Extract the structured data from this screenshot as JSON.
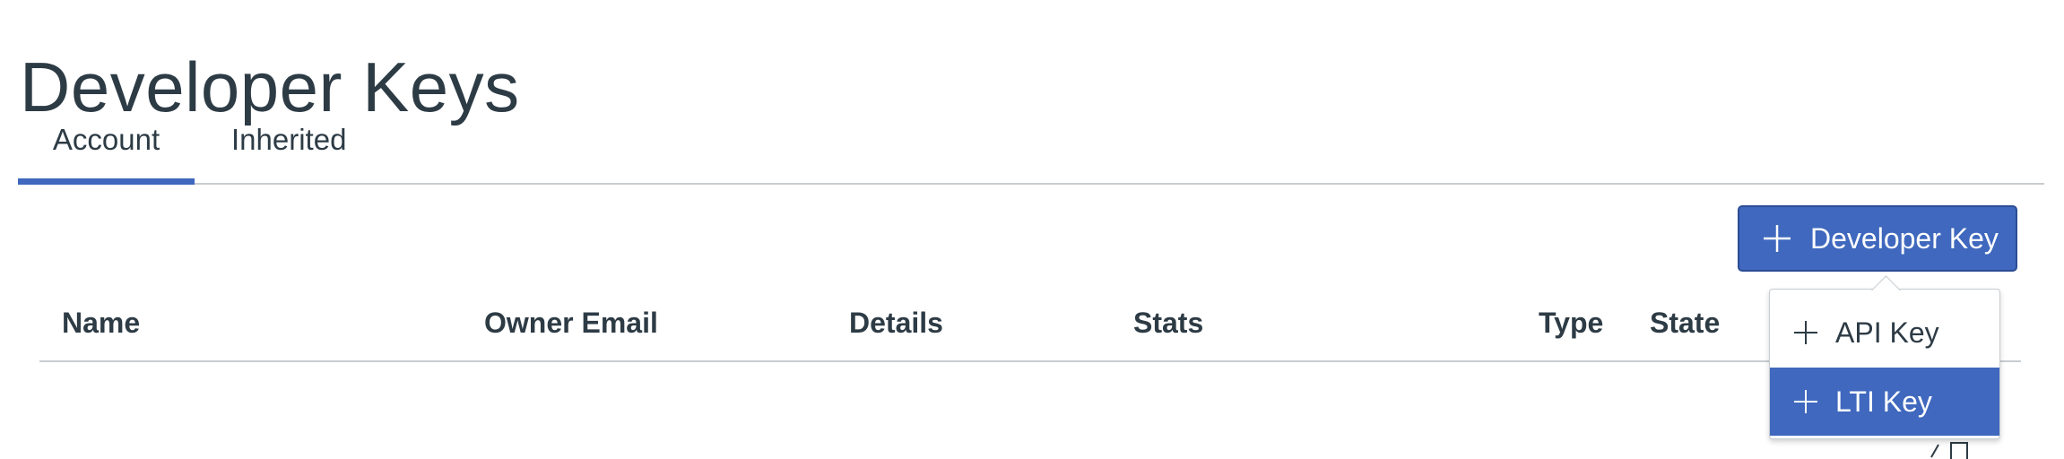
{
  "page": {
    "title": "Developer Keys"
  },
  "tabs": [
    {
      "label": "Account",
      "active": true
    },
    {
      "label": "Inherited",
      "active": false
    }
  ],
  "toolbar": {
    "add_button_label": "Developer Key",
    "add_button_icon": "plus-icon"
  },
  "table": {
    "columns": [
      "Name",
      "Owner Email",
      "Details",
      "Stats",
      "Type",
      "State",
      ""
    ]
  },
  "dropdown": {
    "items": [
      {
        "label": "API Key",
        "icon": "plus-icon",
        "highlighted": false
      },
      {
        "label": "LTI Key",
        "icon": "plus-icon",
        "highlighted": true
      }
    ]
  },
  "colors": {
    "accent": "#3f68be",
    "text": "#2d3b45",
    "divider": "#c7cdd1",
    "background": "#ffffff"
  }
}
